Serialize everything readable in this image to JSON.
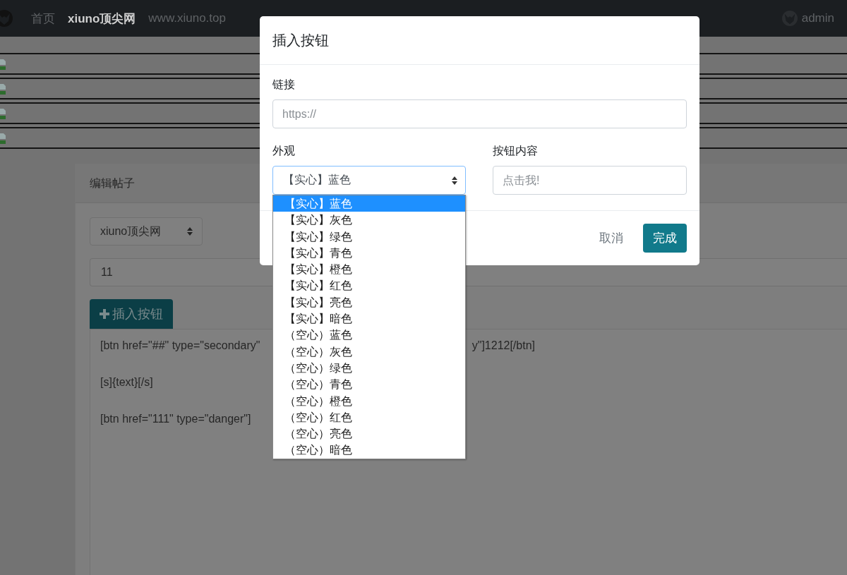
{
  "navbar": {
    "links": [
      {
        "label": "首页",
        "kind": "link"
      },
      {
        "label": "xiuno顶尖网",
        "kind": "brand"
      },
      {
        "label": "www.xiuno.top",
        "kind": "link"
      }
    ],
    "user": "admin"
  },
  "image_rows": [
    {
      "kind": "broken-image"
    },
    {
      "kind": "broken-image"
    },
    {
      "kind": "broken-image"
    },
    {
      "kind": "broken-image"
    }
  ],
  "card": {
    "title": "编辑帖子",
    "forum_select": "xiuno顶尖网",
    "title_input": "11",
    "insert_button": "插入按钮",
    "editor_lines": [
      {
        "parts": [
          "[btn href=\"##\" type=\"secondary\"",
          "y\"]1212[/btn]"
        ]
      },
      {
        "parts": [
          "[s]{text}[/s]"
        ]
      },
      {
        "parts": [
          "[btn href=\"111\" type=\"danger\"]"
        ]
      }
    ]
  },
  "modal": {
    "title": "插入按钮",
    "link_label": "链接",
    "link_placeholder": "https://",
    "appearance_label": "外观",
    "appearance_value": "【实心】蓝色",
    "content_label": "按钮内容",
    "content_placeholder": "点击我!",
    "cancel": "取消",
    "done": "完成",
    "options": [
      {
        "label": "【实心】蓝色",
        "selected": true
      },
      {
        "label": "【实心】灰色",
        "selected": false
      },
      {
        "label": "【实心】绿色",
        "selected": false
      },
      {
        "label": "【实心】青色",
        "selected": false
      },
      {
        "label": "【实心】橙色",
        "selected": false
      },
      {
        "label": "【实心】红色",
        "selected": false
      },
      {
        "label": "【实心】亮色",
        "selected": false
      },
      {
        "label": "【实心】暗色",
        "selected": false
      },
      {
        "label": "（空心）蓝色",
        "selected": false
      },
      {
        "label": "（空心）灰色",
        "selected": false
      },
      {
        "label": "（空心）绿色",
        "selected": false
      },
      {
        "label": "（空心）青色",
        "selected": false
      },
      {
        "label": "（空心）橙色",
        "selected": false
      },
      {
        "label": "（空心）红色",
        "selected": false
      },
      {
        "label": "（空心）亮色",
        "selected": false
      },
      {
        "label": "（空心）暗色",
        "selected": false
      }
    ]
  }
}
